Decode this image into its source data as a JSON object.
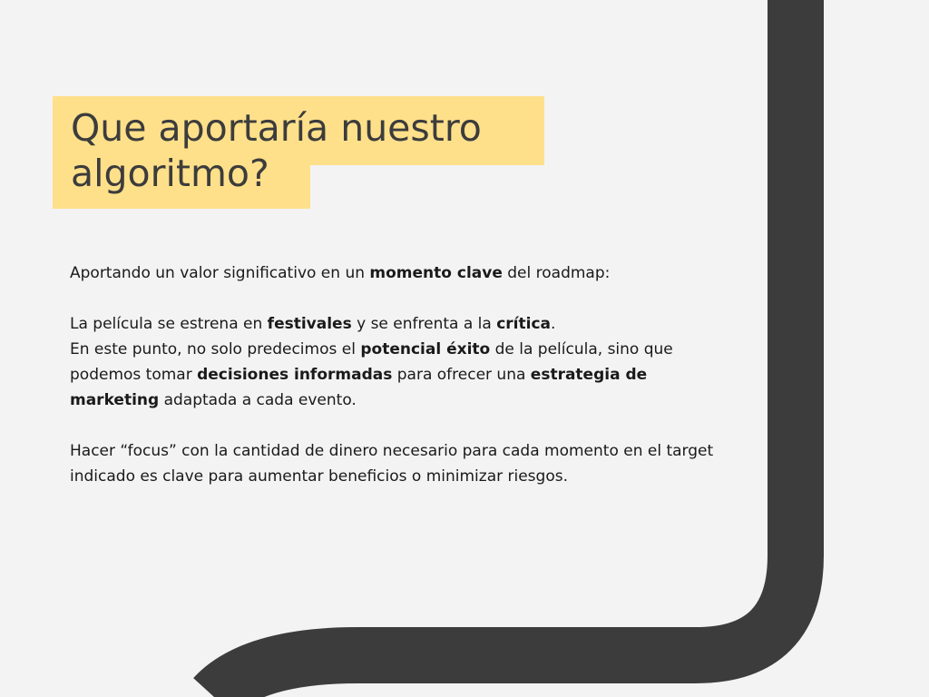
{
  "colors": {
    "background": "#f3f3f3",
    "title_highlight": "#ffe08a",
    "road": "#3c3c3c",
    "title_text": "#3c3c3c",
    "body_text": "#1a1a1a"
  },
  "title": {
    "line1": "Que aportaría nuestro",
    "line2": "algoritmo?"
  },
  "paragraph1": {
    "t1": "Aportando un valor significativo en un ",
    "b1": "momento clave",
    "t2": " del roadmap:"
  },
  "paragraph2": {
    "line1": {
      "t1": "La película se estrena en ",
      "b1": "festivales",
      "t2": " y se enfrenta a la ",
      "b2": "crítica",
      "t3": "."
    },
    "line2": {
      "t1": "En este punto, no solo predecimos el ",
      "b1": "potencial éxito",
      "t2": " de la película, sino que podemos tomar ",
      "b2": "decisiones informadas",
      "t3": " para ofrecer una ",
      "b3": "estrategia de marketing",
      "t4": " adaptada a cada evento."
    }
  },
  "paragraph3": "Hacer “focus” con la cantidad de dinero necesario para cada momento en el target indicado es clave para aumentar beneficios o minimizar riesgos."
}
